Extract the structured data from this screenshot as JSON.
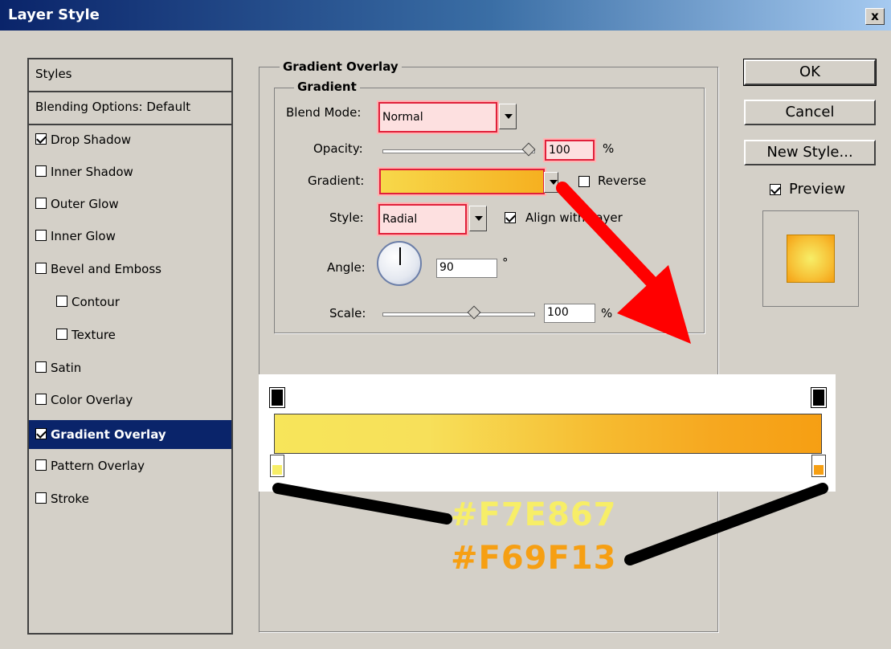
{
  "window": {
    "title": "Layer Style",
    "close_label": "x"
  },
  "sidebar": {
    "header": "Styles",
    "blending": "Blending Options: Default",
    "items": [
      {
        "label": "Drop Shadow",
        "checked": true
      },
      {
        "label": "Inner Shadow",
        "checked": false
      },
      {
        "label": "Outer Glow",
        "checked": false
      },
      {
        "label": "Inner Glow",
        "checked": false
      },
      {
        "label": "Bevel and Emboss",
        "checked": false
      },
      {
        "label": "Contour",
        "checked": false
      },
      {
        "label": "Texture",
        "checked": false
      },
      {
        "label": "Satin",
        "checked": false
      },
      {
        "label": "Color Overlay",
        "checked": false
      },
      {
        "label": "Gradient Overlay",
        "checked": true,
        "selected": true
      },
      {
        "label": "Pattern Overlay",
        "checked": false
      },
      {
        "label": "Stroke",
        "checked": false
      }
    ]
  },
  "panel": {
    "section_title": "Gradient Overlay",
    "group_title": "Gradient",
    "blend_mode": {
      "label": "Blend Mode:",
      "value": "Normal"
    },
    "opacity": {
      "label": "Opacity:",
      "value": "100",
      "unit": "%",
      "level": 1.0
    },
    "gradient": {
      "label": "Gradient:",
      "reverse_label": "Reverse",
      "reverse_checked": false
    },
    "style": {
      "label": "Style:",
      "value": "Radial",
      "align_label": "Align with Layer",
      "align_checked": true
    },
    "angle": {
      "label": "Angle:",
      "value": "90",
      "unit": "°"
    },
    "scale": {
      "label": "Scale:",
      "value": "100",
      "unit": "%",
      "level": 0.6
    }
  },
  "buttons": {
    "ok": "OK",
    "cancel": "Cancel",
    "new_style": "New Style...",
    "preview_label": "Preview",
    "preview_checked": true
  },
  "gradient_editor": {
    "stop_left_color": "#F7EE67",
    "stop_right_color": "#F69F13"
  },
  "annotations": {
    "color1": "#F7EE67",
    "color2": "#F69F13",
    "color1_display": "#F7E867",
    "color2_display": "#F69F13"
  }
}
